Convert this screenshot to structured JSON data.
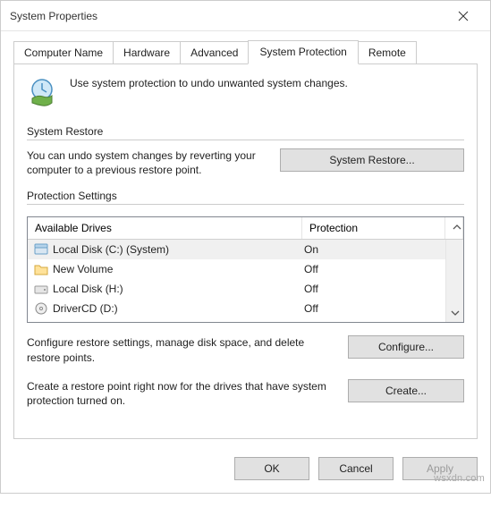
{
  "window": {
    "title": "System Properties"
  },
  "tabs": {
    "computer_name": "Computer Name",
    "hardware": "Hardware",
    "advanced": "Advanced",
    "system_protection": "System Protection",
    "remote": "Remote"
  },
  "intro": "Use system protection to undo unwanted system changes.",
  "system_restore": {
    "group_label": "System Restore",
    "description": "You can undo system changes by reverting your computer to a previous restore point.",
    "button": "System Restore..."
  },
  "protection_settings": {
    "group_label": "Protection Settings",
    "header_drives": "Available Drives",
    "header_protection": "Protection",
    "drives": [
      {
        "name": "Local Disk (C:) (System)",
        "protection": "On",
        "icon": "drive-blue"
      },
      {
        "name": "New Volume",
        "protection": "Off",
        "icon": "folder"
      },
      {
        "name": "Local Disk (H:)",
        "protection": "Off",
        "icon": "drive-gray"
      },
      {
        "name": "DriverCD (D:)",
        "protection": "Off",
        "icon": "disc"
      }
    ],
    "configure_text": "Configure restore settings, manage disk space, and delete restore points.",
    "configure_button": "Configure...",
    "create_text": "Create a restore point right now for the drives that have system protection turned on.",
    "create_button": "Create..."
  },
  "footer": {
    "ok": "OK",
    "cancel": "Cancel",
    "apply": "Apply"
  },
  "watermark": "wsxdn.com"
}
